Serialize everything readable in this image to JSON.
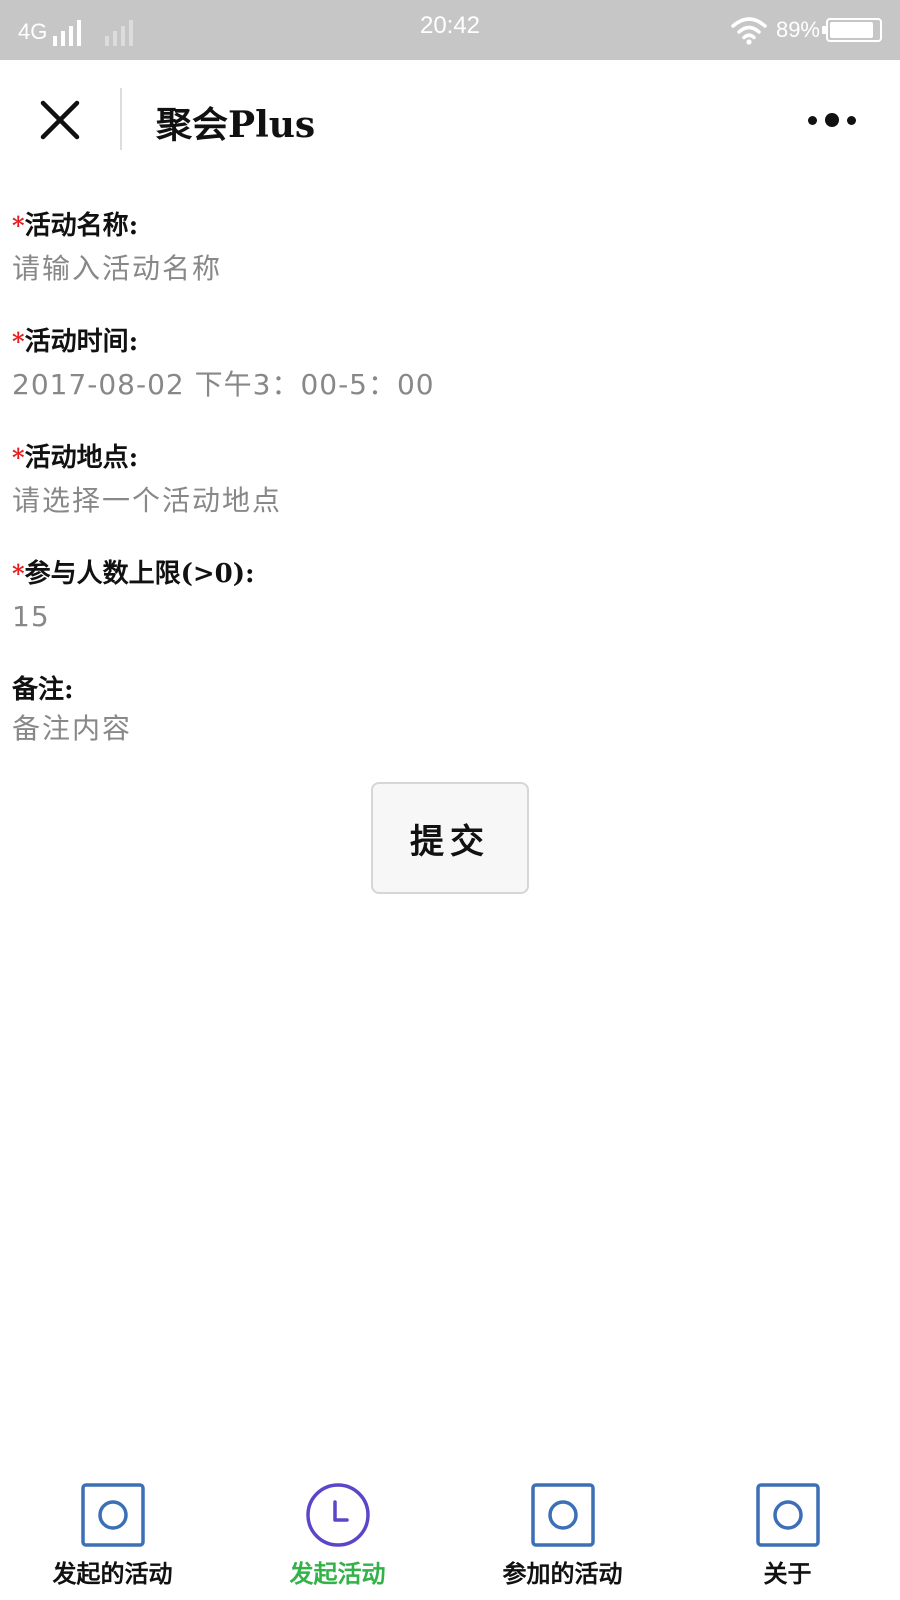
{
  "status_bar": {
    "network": "4G",
    "time": "20:42",
    "battery": "89%",
    "battery_level": 0.89
  },
  "header": {
    "title": "聚会Plus",
    "close_icon": "close-icon",
    "more_icon": "more-dots-icon"
  },
  "form": {
    "name": {
      "label": "活动名称:",
      "required": "*",
      "placeholder": "请输入活动名称"
    },
    "time": {
      "label": "活动时间:",
      "required": "*",
      "value": "2017-08-02 下午3：00-5：00"
    },
    "location": {
      "label": "活动地点:",
      "required": "*",
      "placeholder": "请选择一个活动地点"
    },
    "capacity": {
      "label": "参与人数上限(>0):",
      "required": "*",
      "value": "15"
    },
    "notes": {
      "label": "备注:",
      "placeholder": "备注内容"
    },
    "submit_label": "提交"
  },
  "tab_bar": {
    "items": [
      {
        "label": "发起的活动",
        "icon": "square-circle-icon",
        "active": false
      },
      {
        "label": "发起活动",
        "icon": "clock-icon",
        "active": true
      },
      {
        "label": "参加的活动",
        "icon": "square-circle-icon",
        "active": false
      },
      {
        "label": "关于",
        "icon": "square-circle-icon",
        "active": false
      }
    ]
  },
  "colors": {
    "status_bar_bg": "#c6c6c6",
    "required": "#e02020",
    "active_tab": "#33b249",
    "tab_icon_blue": "#3b6fb6",
    "tab_icon_purple": "#5a46c8"
  }
}
